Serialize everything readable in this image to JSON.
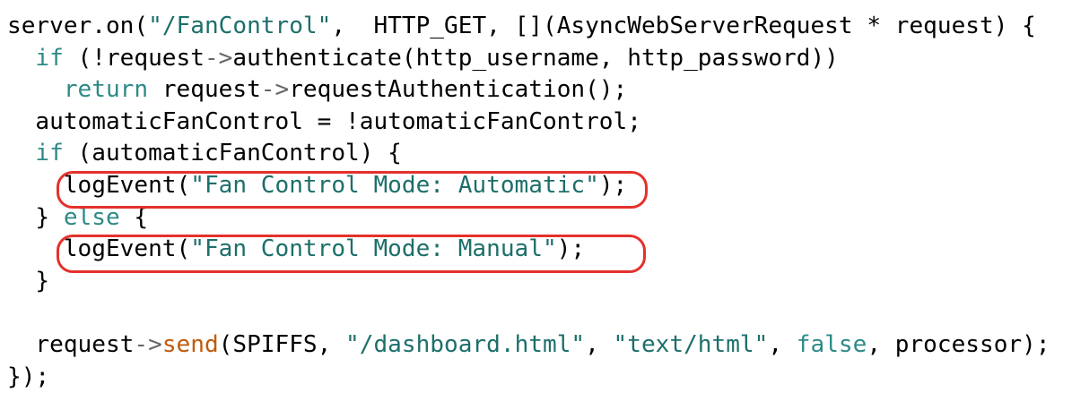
{
  "code_lines": [
    {
      "indent": "",
      "tokens": [
        {
          "t": "server.on(",
          "c": "plain"
        },
        {
          "t": "\"/FanControl\"",
          "c": "str"
        },
        {
          "t": ",  HTTP_GET, [](AsyncWebServerRequest * request) {",
          "c": "plain"
        }
      ]
    },
    {
      "indent": "  ",
      "tokens": [
        {
          "t": "if",
          "c": "kw"
        },
        {
          "t": " (!request",
          "c": "plain"
        },
        {
          "t": "->",
          "c": "op"
        },
        {
          "t": "authenticate(http_username, http_password))",
          "c": "plain"
        }
      ]
    },
    {
      "indent": "    ",
      "tokens": [
        {
          "t": "return",
          "c": "kw"
        },
        {
          "t": " request",
          "c": "plain"
        },
        {
          "t": "->",
          "c": "op"
        },
        {
          "t": "requestAuthentication();",
          "c": "plain"
        }
      ]
    },
    {
      "indent": "  ",
      "tokens": [
        {
          "t": "automaticFanControl = !automaticFanControl;",
          "c": "plain"
        }
      ]
    },
    {
      "indent": "  ",
      "tokens": [
        {
          "t": "if",
          "c": "kw"
        },
        {
          "t": " (automaticFanControl) {",
          "c": "plain"
        }
      ]
    },
    {
      "indent": "    ",
      "tokens": [
        {
          "t": "logEvent(",
          "c": "plain"
        },
        {
          "t": "\"Fan Control Mode: Automatic\"",
          "c": "str"
        },
        {
          "t": ");",
          "c": "plain"
        }
      ]
    },
    {
      "indent": "  ",
      "tokens": [
        {
          "t": "} ",
          "c": "plain"
        },
        {
          "t": "else",
          "c": "kw"
        },
        {
          "t": " {",
          "c": "plain"
        }
      ]
    },
    {
      "indent": "    ",
      "tokens": [
        {
          "t": "logEvent(",
          "c": "plain"
        },
        {
          "t": "\"Fan Control Mode: Manual\"",
          "c": "str"
        },
        {
          "t": ");",
          "c": "plain"
        }
      ]
    },
    {
      "indent": "  ",
      "tokens": [
        {
          "t": "}",
          "c": "plain"
        }
      ]
    },
    {
      "indent": "",
      "tokens": []
    },
    {
      "indent": "  ",
      "tokens": [
        {
          "t": "request",
          "c": "plain"
        },
        {
          "t": "->",
          "c": "op"
        },
        {
          "t": "send",
          "c": "fn"
        },
        {
          "t": "(SPIFFS, ",
          "c": "plain"
        },
        {
          "t": "\"/dashboard.html\"",
          "c": "str"
        },
        {
          "t": ", ",
          "c": "plain"
        },
        {
          "t": "\"text/html\"",
          "c": "str"
        },
        {
          "t": ", ",
          "c": "plain"
        },
        {
          "t": "false",
          "c": "kw"
        },
        {
          "t": ", processor);",
          "c": "plain"
        }
      ]
    },
    {
      "indent": "",
      "tokens": [
        {
          "t": "});",
          "c": "plain"
        }
      ]
    }
  ],
  "colors": {
    "keyword": "#2d8a86",
    "string": "#1d6f6b",
    "operator": "#666666",
    "function": "#c25a0a",
    "highlight_border": "#e4312b",
    "background": "#ffffff"
  }
}
